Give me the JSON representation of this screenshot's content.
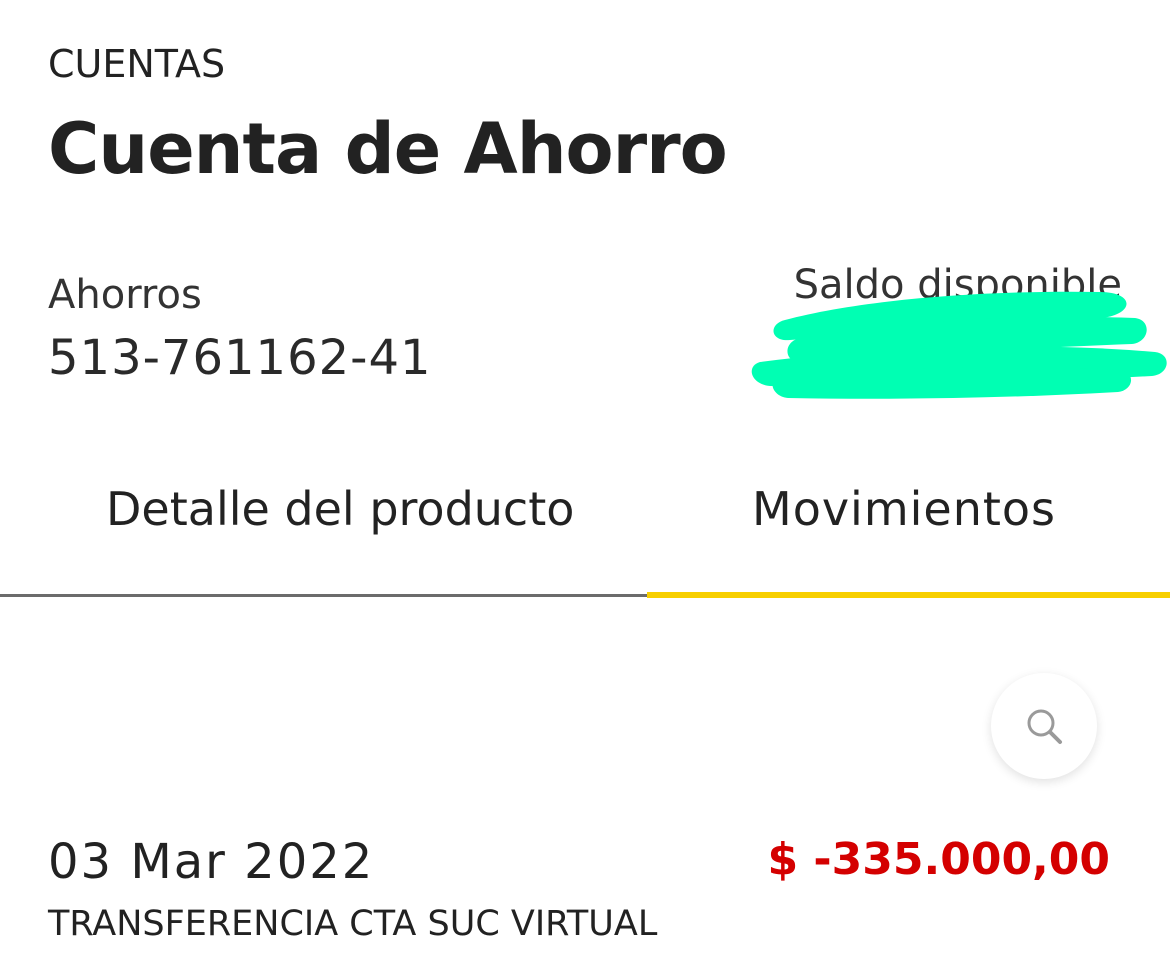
{
  "header": {
    "section": "CUENTAS",
    "title": "Cuenta de Ahorro"
  },
  "account": {
    "type": "Ahorros",
    "number": "513-761162-41",
    "balance_label": "Saldo disponible",
    "balance_value": "",
    "redaction_color": "#00ffb3"
  },
  "tabs": [
    {
      "label": "Detalle del producto",
      "active": false
    },
    {
      "label": "Movimientos",
      "active": true
    }
  ],
  "colors": {
    "active_tab_indicator": "#f7cf00",
    "negative_amount": "#d40000"
  },
  "search": {
    "icon": "search-icon"
  },
  "transactions": [
    {
      "date": "03 Mar 2022",
      "amount": "$ -335.000,00",
      "description": "TRANSFERENCIA CTA SUC VIRTUAL"
    }
  ]
}
